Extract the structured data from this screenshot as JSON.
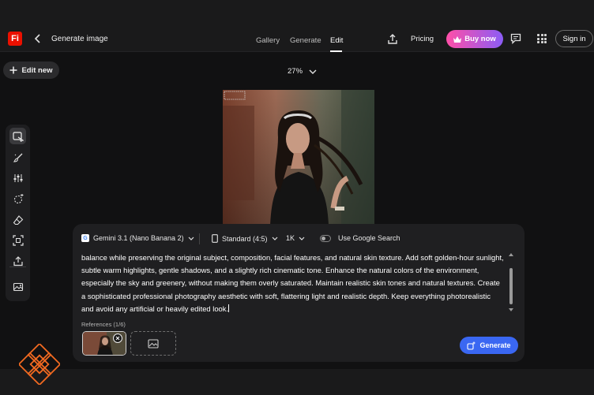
{
  "header": {
    "logo_text": "Fi",
    "breadcrumb": "Generate image",
    "tabs": [
      {
        "label": "Gallery"
      },
      {
        "label": "Generate"
      },
      {
        "label": "Edit"
      }
    ],
    "active_tab": "Edit",
    "pricing_label": "Pricing",
    "buy_label": "Buy now",
    "signin_label": "Sign in"
  },
  "canvas": {
    "edit_new_label": "Edit new",
    "zoom_label": "27%"
  },
  "toolbar": {
    "tools": [
      {
        "name": "select-edit-icon",
        "selected": true
      },
      {
        "name": "brush-icon"
      },
      {
        "name": "adjust-icon"
      },
      {
        "name": "magic-fill-icon"
      },
      {
        "name": "eraser-icon"
      },
      {
        "name": "crop-expand-icon"
      },
      {
        "name": "upload-icon"
      },
      {
        "name": "image-icon"
      }
    ]
  },
  "prompt_panel": {
    "model_label": "Gemini 3.1 (Nano Banana 2)",
    "aspect_label": "Standard (4:5)",
    "resolution_label": "1K",
    "google_search_label": "Use Google Search",
    "google_search_enabled": false,
    "prompt_text": "balance while preserving the original subject, composition, facial features, and natural skin texture. Add soft golden-hour sunlight, subtle warm highlights, gentle shadows, and a slightly rich cinematic tone. Enhance the natural colors of the environment, especially the sky and greenery, without making them overly saturated. Maintain realistic skin tones and natural textures. Create a sophisticated professional photography aesthetic with soft, flattering light and realistic depth. Keep everything photorealistic and avoid any artificial or heavily edited look.",
    "references_label": "References (1/6)",
    "generate_label": "Generate"
  },
  "colors": {
    "accent": "#3a67f2",
    "brand": "#eb1000",
    "buy_gradient_start": "#ff4fa8",
    "buy_gradient_end": "#8b5cf6",
    "watermark": "#f26a21"
  }
}
